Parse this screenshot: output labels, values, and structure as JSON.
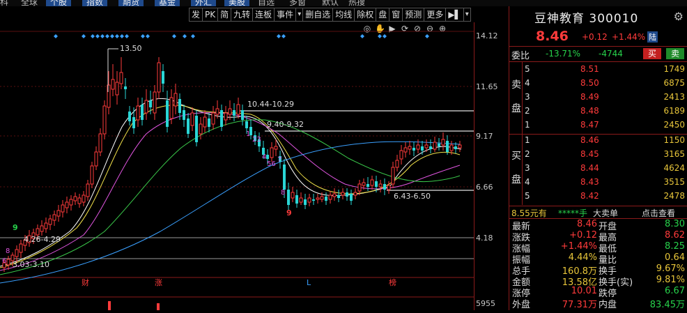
{
  "top_tabs": [
    "科",
    "全球",
    "个股",
    "指数",
    "期货",
    "基金",
    "外汇",
    "美股",
    "自选",
    "多窗",
    "默认",
    "热搜"
  ],
  "toolbar": {
    "items": [
      "发",
      "PK",
      "简",
      "九转",
      "连板",
      "事件",
      "▾",
      "删自选",
      "均线",
      "除权",
      "盘",
      "窗",
      "预测",
      "更多",
      "▶▌",
      "▾"
    ]
  },
  "chart_icons": [
    "◎",
    "✋",
    "▶",
    "⟳",
    "⊘",
    "⊖",
    "⊕"
  ],
  "price_axis": [
    "14.12",
    "11.65",
    "9.17",
    "6.66",
    "4.18",
    "5955"
  ],
  "chart_annotations": {
    "high": "13.50",
    "r1": "10.44-10.29",
    "r2": "9.40-9.32",
    "r3": "6.43-6.50",
    "s1": "4.26-4.29",
    "s2": "3.03-3.10",
    "bottom_labels": [
      "财",
      "涨",
      "L",
      "榜"
    ],
    "td_seq_red": [
      "8",
      "9",
      "7",
      "9",
      "8",
      "9"
    ],
    "td_seq_magenta": [
      "1",
      "23",
      "4",
      "56",
      "7"
    ]
  },
  "quote": {
    "name": "豆神教育",
    "code": "300010",
    "price": "8.46",
    "change": "+0.12",
    "pct": "+1.44%",
    "market": "陆"
  },
  "weibi": {
    "label": "委比",
    "ratio": "-13.71%",
    "diff": "-4744",
    "buy": "买",
    "sell": "卖"
  },
  "orderbook": {
    "sell_label": [
      "卖",
      "盘"
    ],
    "buy_label": [
      "买",
      "盘"
    ],
    "sell": [
      {
        "lv": "5",
        "price": "8.51",
        "vol": "1749"
      },
      {
        "lv": "4",
        "price": "8.50",
        "vol": "6875"
      },
      {
        "lv": "3",
        "price": "8.49",
        "vol": "2413"
      },
      {
        "lv": "2",
        "price": "8.48",
        "vol": "6189"
      },
      {
        "lv": "1",
        "price": "8.47",
        "vol": "2450"
      }
    ],
    "buy": [
      {
        "lv": "1",
        "price": "8.46",
        "vol": "1150"
      },
      {
        "lv": "2",
        "price": "8.45",
        "vol": "3165"
      },
      {
        "lv": "3",
        "price": "8.44",
        "vol": "4624"
      },
      {
        "lv": "4",
        "price": "8.43",
        "vol": "3515"
      },
      {
        "lv": "5",
        "price": "8.42",
        "vol": "2478"
      }
    ]
  },
  "tick_bar": {
    "price": "8.55元有",
    "stars": "*****手",
    "big": "大卖单",
    "link": "点击查看"
  },
  "stats": [
    {
      "k1": "最新",
      "v1": "8.46",
      "c1": "red",
      "k2": "开盘",
      "v2": "8.30",
      "c2": "green"
    },
    {
      "k1": "涨跌",
      "v1": "+0.12",
      "c1": "red",
      "k2": "最高",
      "v2": "8.62",
      "c2": "red"
    },
    {
      "k1": "涨幅",
      "v1": "+1.44%",
      "c1": "red",
      "k2": "最低",
      "v2": "8.25",
      "c2": "green"
    },
    {
      "k1": "振幅",
      "v1": "4.44%",
      "c1": "yellow",
      "k2": "量比",
      "v2": "0.64",
      "c2": "yellow"
    },
    {
      "k1": "总手",
      "v1": "160.8万",
      "c1": "yellow",
      "k2": "换手",
      "v2": "9.67%",
      "c2": "yellow"
    },
    {
      "k1": "金额",
      "v1": "13.58亿",
      "c1": "yellow",
      "k2": "换手(实)",
      "v2": "9.81%",
      "c2": "yellow"
    },
    {
      "k1": "涨停",
      "v1": "10.01",
      "c1": "red",
      "k2": "跌停",
      "v2": "6.67",
      "c2": "green"
    },
    {
      "k1": "外盘",
      "v1": "77.31万",
      "c1": "red",
      "k2": "内盘",
      "v2": "83.45万",
      "c2": "green"
    }
  ],
  "colors": {
    "up": "#ff3b3b",
    "down": "#2ad6d6",
    "ma5": "#ffffff",
    "ma10": "#f2e24a",
    "ma20": "#e055e0",
    "ma60": "#3ac94a",
    "ma120": "#3aa0ff"
  }
}
